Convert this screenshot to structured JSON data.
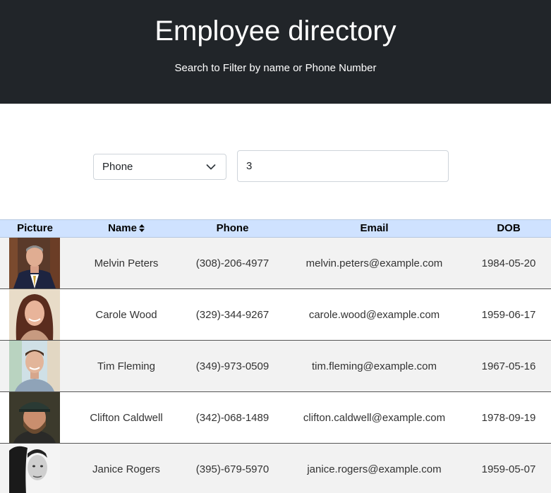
{
  "header": {
    "title": "Employee directory",
    "subtitle": "Search to Filter by name or Phone Number"
  },
  "filter": {
    "field_selected": "Phone",
    "search_value": "3"
  },
  "table": {
    "columns": {
      "picture": "Picture",
      "name": "Name",
      "phone": "Phone",
      "email": "Email",
      "dob": "DOB"
    },
    "rows": [
      {
        "name": "Melvin Peters",
        "phone": "(308)-206-4977",
        "email": "melvin.peters@example.com",
        "dob": "1984-05-20"
      },
      {
        "name": "Carole Wood",
        "phone": "(329)-344-9267",
        "email": "carole.wood@example.com",
        "dob": "1959-06-17"
      },
      {
        "name": "Tim Fleming",
        "phone": "(349)-973-0509",
        "email": "tim.fleming@example.com",
        "dob": "1967-05-16"
      },
      {
        "name": "Clifton Caldwell",
        "phone": "(342)-068-1489",
        "email": "clifton.caldwell@example.com",
        "dob": "1978-09-19"
      },
      {
        "name": "Janice Rogers",
        "phone": "(395)-679-5970",
        "email": "janice.rogers@example.com",
        "dob": "1959-05-07"
      }
    ]
  },
  "colors": {
    "header_bg": "#212529",
    "table_head_bg": "#cfe2ff",
    "row_stripe": "#f2f2f2"
  },
  "icons": {
    "select_chevron": "chevron-down-icon",
    "sort": "sort-icon"
  }
}
